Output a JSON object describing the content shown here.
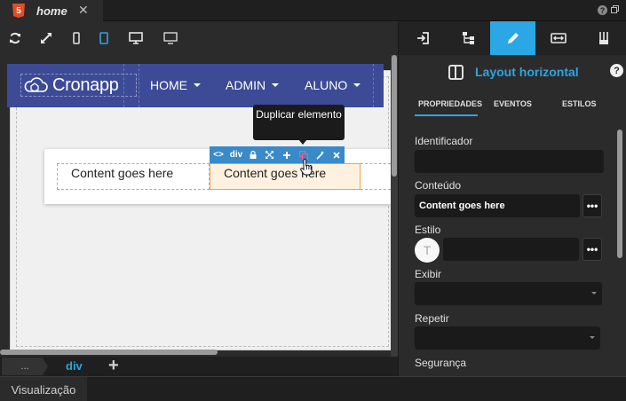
{
  "tab": {
    "title": "home",
    "html5": "5",
    "close": "✕"
  },
  "window": {
    "help": "?"
  },
  "devices": [
    "refresh-icon",
    "fullscreen-icon",
    "mobile-icon",
    "tablet-icon",
    "desktop-icon",
    "monitor-icon"
  ],
  "preview": {
    "logo": "Cronapp",
    "nav": [
      {
        "label": "HOME"
      },
      {
        "label": "ADMIN"
      },
      {
        "label": "ALUNO"
      }
    ],
    "col1_text": "Content goes here",
    "col2_text": "Content goes here"
  },
  "element_toolbar": {
    "tag_label": "div",
    "code": "<>",
    "tooltip": "Duplicar elemento"
  },
  "breadcrumb": {
    "first": "...",
    "current": "div",
    "add": "+"
  },
  "status": {
    "tab": "Visualização"
  },
  "panel": {
    "title": "Layout horizontal",
    "help": "?",
    "subtabs": [
      "PROPRIEDADES",
      "EVENTOS",
      "ESTILOS"
    ],
    "fields": {
      "identificador_label": "Identificador",
      "identificador_value": "",
      "conteudo_label": "Conteúdo",
      "conteudo_value": "Content goes here",
      "estilo_label": "Estilo",
      "estilo_avatar": "T",
      "exibir_label": "Exibir",
      "repetir_label": "Repetir",
      "seguranca_label": "Segurança"
    },
    "dots": "•••"
  },
  "colors": {
    "accent": "#2aa7e4",
    "navbar": "#3d4a96",
    "selected": "#f5a04a"
  }
}
